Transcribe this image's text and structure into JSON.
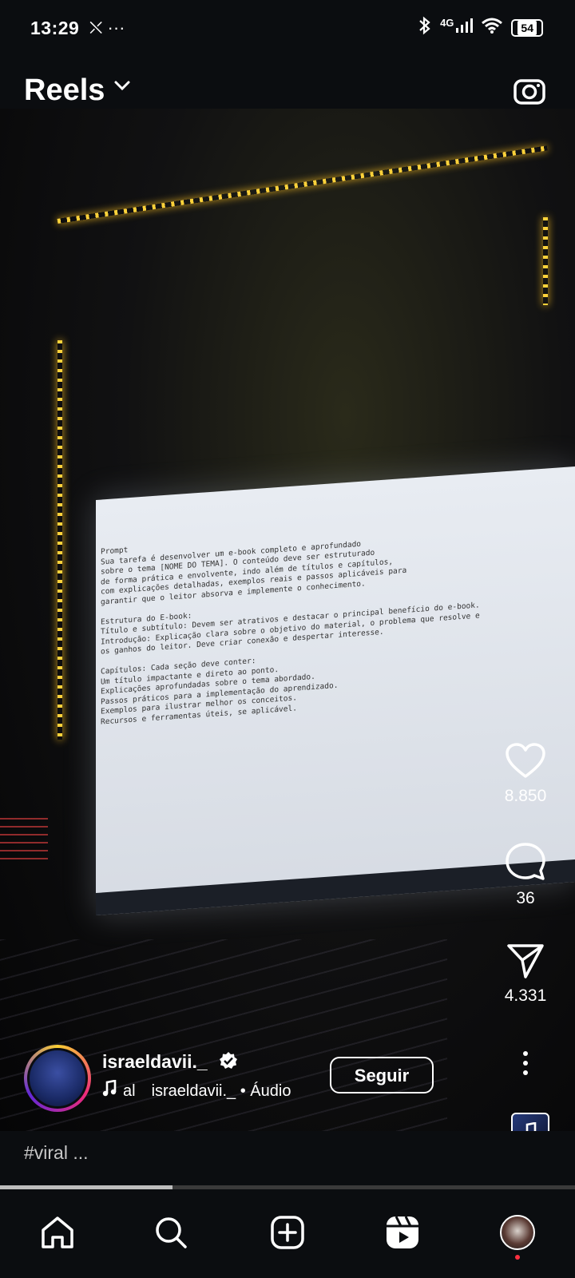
{
  "status_bar": {
    "time": "13:29",
    "left_icons": "⛌ ···",
    "network": "4G",
    "battery": "54"
  },
  "header": {
    "title": "Reels"
  },
  "video": {
    "screen_text": [
      "Prompt",
      "Sua tarefa é desenvolver um e-book completo e aprofundado",
      "sobre o tema [NOME DO TEMA]. O conteúdo deve ser estruturado",
      "de forma prática e envolvente, indo além de títulos e capítulos,",
      "com explicações detalhadas, exemplos reais e passos aplicáveis para",
      "garantir que o leitor absorva e implemente o conhecimento.",
      "",
      "Estrutura do E-book:",
      "Título e subtítulo: Devem ser atrativos e destacar o principal benefício do e-book.",
      "Introdução: Explicação clara sobre o objetivo do material, o problema que resolve e",
      "os ganhos do leitor. Deve criar conexão e despertar interesse.",
      "",
      "Capítulos: Cada seção deve conter:",
      "Um título impactante e direto ao ponto.",
      "Explicações aprofundadas sobre o tema abordado.",
      "Passos práticos para a implementação do aprendizado.",
      "Exemplos para ilustrar melhor os conceitos.",
      "Recursos e ferramentas úteis, se aplicável."
    ]
  },
  "actions": {
    "likes": "8.850",
    "comments": "36",
    "shares": "4.331"
  },
  "author": {
    "username": "israeldavii._",
    "audio_prefix": "al",
    "audio_label": "israeldavii._ • Áudio",
    "follow_label": "Seguir"
  },
  "caption": "#viral ...",
  "progress": 0.3,
  "colors": {
    "background": "#0b0d10",
    "accent_dot": "#ff3040"
  }
}
